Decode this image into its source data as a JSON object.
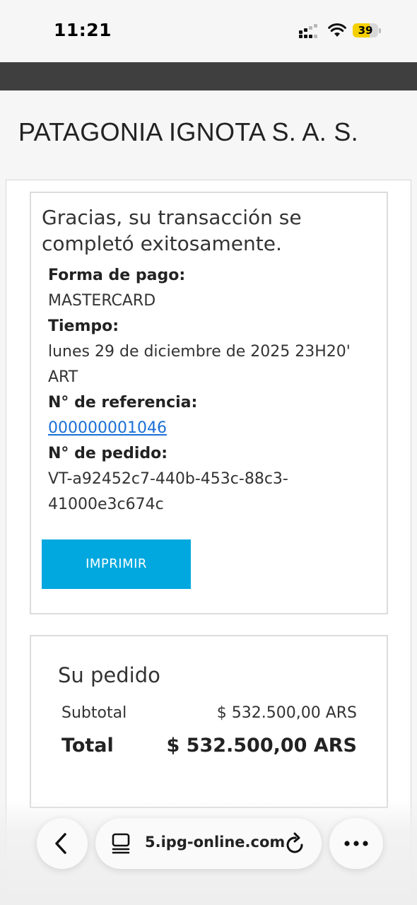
{
  "status_bar": {
    "time": "11:21",
    "battery_level": "39",
    "battery_color": "#f5d000",
    "icons": [
      "signal-icon",
      "wifi-icon",
      "battery-icon"
    ]
  },
  "header": {
    "company_name": "PATAGONIA IGNOTA S. A. S."
  },
  "confirmation": {
    "title": "Gracias, su transacción se completó exitosamente.",
    "payment_method_label": "Forma de pago:",
    "payment_method_value": "MASTERCARD",
    "time_label": "Tiempo:",
    "time_value_line1": "lunes 29 de diciembre de 2025 23H20'",
    "time_value_line2": "ART",
    "reference_label": "N° de referencia:",
    "reference_value": "000000001046",
    "order_label": "N° de pedido:",
    "order_value_line1": "VT-a92452c7-440b-453c-88c3-",
    "order_value_line2": "41000e3c674c",
    "print_button": "IMPRIMIR",
    "accent_color": "#00a8df",
    "link_color": "#1a6fd6"
  },
  "order_summary": {
    "title": "Su pedido",
    "subtotal_label": "Subtotal",
    "subtotal_value": "$ 532.500,00 ARS",
    "total_label": "Total",
    "total_value": "$ 532.500,00 ARS"
  },
  "browser_bar": {
    "url": "5.ipg-online.com",
    "icons": [
      "back-chevron-icon",
      "tabs-icon",
      "reload-icon",
      "more-icon"
    ]
  }
}
